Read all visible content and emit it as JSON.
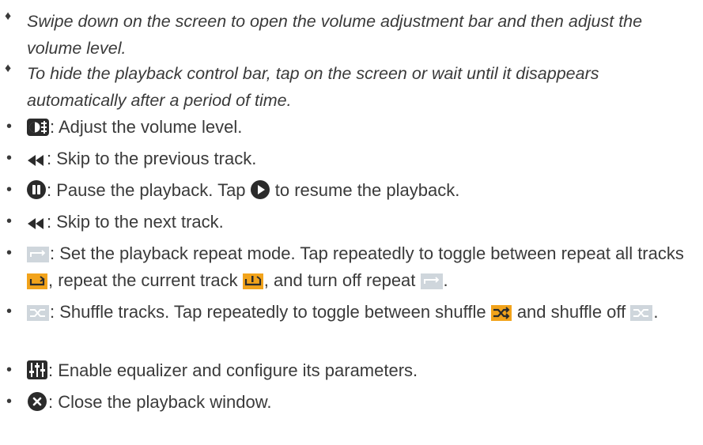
{
  "notes": [
    {
      "marker": "♦",
      "text": "Swipe down on the screen to open the volume adjustment bar and then adjust the volume level."
    },
    {
      "marker": "♦",
      "text": "To hide the playback control bar, tap on the screen or wait until it disappears automatically after a period of time."
    }
  ],
  "bullet": "•",
  "items": {
    "volume": {
      "icon": "volume-icon",
      "text": ": Adjust the volume level."
    },
    "previous": {
      "icon": "rewind-icon",
      "text": ": Skip to the previous track."
    },
    "pause": {
      "icon": "pause-icon",
      "text_a": ": Pause the playback. Tap ",
      "icon2": "play-icon",
      "text_b": " to resume the playback."
    },
    "next": {
      "icon": "rewind-icon",
      "text": ": Skip to the next track."
    },
    "repeat": {
      "icon": "repeat-off-icon",
      "text_a": ": Set the playback repeat mode. Tap repeatedly to toggle between repeat all tracks ",
      "text_b": ", repeat the current track ",
      "text_c": ", and turn off repeat ",
      "text_d": "."
    },
    "shuffle": {
      "icon": "shuffle-off-icon",
      "text_a": ": Shuffle tracks. Tap repeatedly to toggle between shuffle ",
      "text_b": " and shuffle off ",
      "text_c": "."
    },
    "equalizer": {
      "icon": "equalizer-icon",
      "text": ": Enable equalizer and configure its parameters."
    },
    "close": {
      "icon": "close-icon",
      "text": ": Close the playback window."
    }
  },
  "colors": {
    "text": "#3a3a3a",
    "icon_dark": "#2b2b2b",
    "accent_orange": "#f2a31b",
    "inactive_grey": "#cfd6dc"
  }
}
